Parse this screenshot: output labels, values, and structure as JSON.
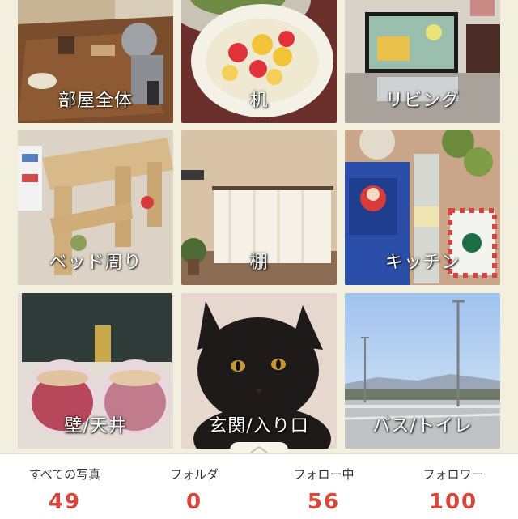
{
  "rooms": [
    {
      "label": "部屋全体",
      "icon": "living-room-table-photo"
    },
    {
      "label": "机",
      "icon": "fruit-plate-photo"
    },
    {
      "label": "リビング",
      "icon": "tv-living-photo"
    },
    {
      "label": "ベッド周り",
      "icon": "wooden-bench-photo"
    },
    {
      "label": "棚",
      "icon": "curtain-window-photo"
    },
    {
      "label": "キッチン",
      "icon": "kitchen-shelf-photo"
    },
    {
      "label": "壁/天井",
      "icon": "tea-tins-photo"
    },
    {
      "label": "玄関/入り口",
      "icon": "black-cat-photo"
    },
    {
      "label": "バス/トイレ",
      "icon": "bridge-sky-photo"
    }
  ],
  "stats": [
    {
      "label": "すべての写真",
      "value": "49"
    },
    {
      "label": "フォルダ",
      "value": "0"
    },
    {
      "label": "フォロー中",
      "value": "56"
    },
    {
      "label": "フォロワー",
      "value": "100"
    }
  ],
  "colors": {
    "background": "#f3efdf",
    "stat_value": "#d9473b",
    "label_text": "#ffffff"
  }
}
